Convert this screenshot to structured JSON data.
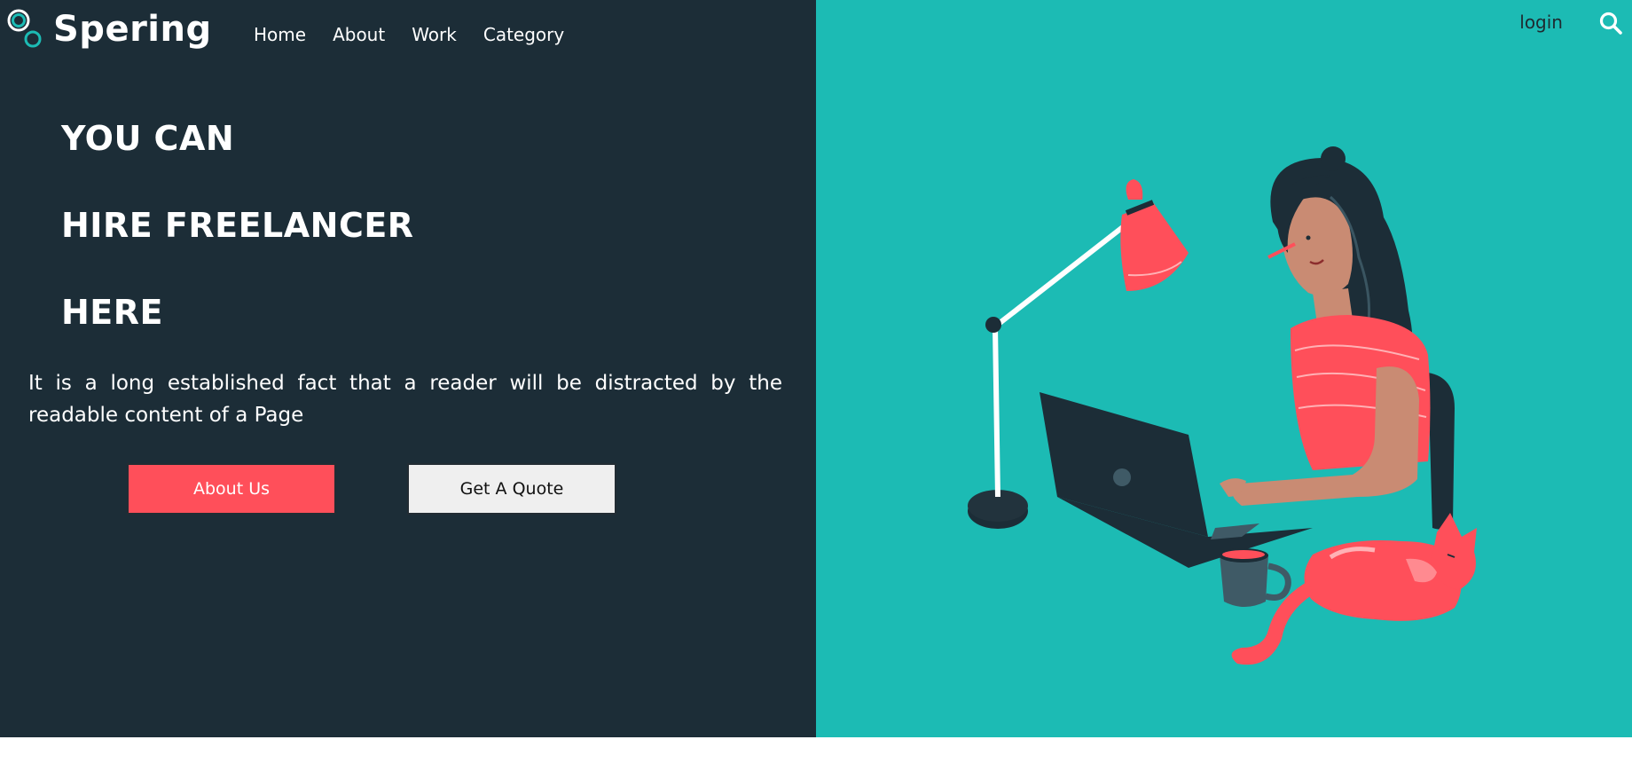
{
  "brand": {
    "name": "Spering"
  },
  "nav": {
    "items": [
      "Home",
      "About",
      "Work",
      "Category"
    ]
  },
  "header_right": {
    "login_label": "login",
    "search_icon": "search-icon"
  },
  "hero": {
    "lines": [
      "YOU CAN",
      "HIRE FREELANCER",
      "HERE"
    ],
    "description": "It is a long established fact that a reader will be distracted by the readable content of a Page",
    "primary_button": "About Us",
    "secondary_button": "Get A Quote"
  },
  "colors": {
    "left_panel": "#1c2d37",
    "right_panel": "#1cbbb4",
    "accent": "#ff4f5a",
    "secondary_button": "#efefef"
  },
  "illustration": {
    "icon": "woman-working-laptop-illustration"
  }
}
